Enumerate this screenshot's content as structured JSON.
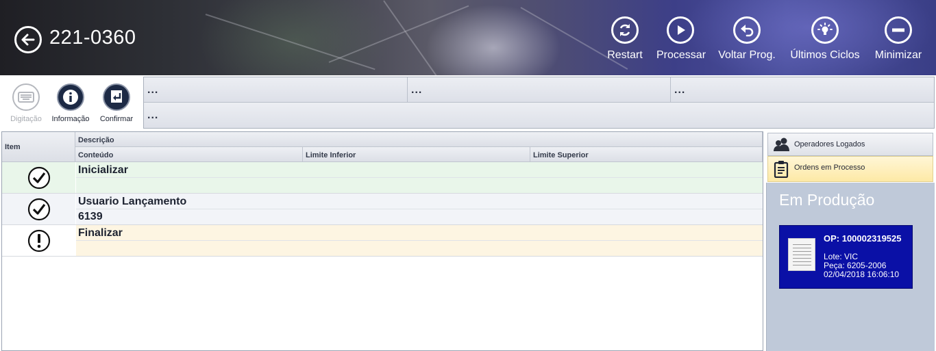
{
  "header": {
    "title": "221-0360",
    "back_icon": "arrow-left-icon",
    "actions": [
      {
        "label": "Restart",
        "icon": "restart-icon"
      },
      {
        "label": "Processar",
        "icon": "play-icon"
      },
      {
        "label": "Voltar Prog.",
        "icon": "undo-icon"
      },
      {
        "label": "Últimos Ciclos",
        "icon": "lightbulb-icon"
      },
      {
        "label": "Minimizar",
        "icon": "minus-icon"
      }
    ]
  },
  "toolbar": {
    "buttons": [
      {
        "label": "Digitação",
        "icon": "keyboard-icon",
        "enabled": false
      },
      {
        "label": "Informação",
        "icon": "info-icon",
        "enabled": true
      },
      {
        "label": "Confirmar",
        "icon": "enter-icon",
        "enabled": true
      }
    ],
    "info_cells": [
      "...",
      "...",
      "...",
      "..."
    ]
  },
  "table": {
    "headers": {
      "item": "Item",
      "descricao": "Descrição",
      "conteudo": "Conteúdo",
      "limite_inferior": "Limite Inferior",
      "limite_superior": "Limite Superior"
    },
    "rows": [
      {
        "descricao": "Inicializar",
        "conteudo": "",
        "status": "done",
        "icon": "check-circle-icon",
        "bg": "#e9f6ea"
      },
      {
        "descricao": "Usuario Lançamento",
        "conteudo": "6139",
        "status": "done",
        "icon": "check-circle-icon",
        "bg": "#f2f4f8"
      },
      {
        "descricao": "Finalizar",
        "conteudo": "",
        "status": "pending",
        "icon": "exclamation-circle-icon",
        "bg": "#fdf5e2"
      }
    ]
  },
  "side": {
    "tabs": [
      {
        "label": "Operadores Logados",
        "icon": "users-icon"
      },
      {
        "label": "Ordens em Processo",
        "icon": "clipboard-icon"
      }
    ],
    "heading": "Em Produção",
    "card": {
      "op": "OP: 100002319525",
      "lote": "Lote: VIC",
      "peca": "Peça: 6205-2006",
      "data": "02/04/2018 16:06:10",
      "icon": "document-icon"
    }
  },
  "colors": {
    "card_blue": "#0a10a6",
    "panel_bg": "#bfc9d9",
    "active_tab": "#fde9a6",
    "row_done": "#e9f6ea",
    "row_pending": "#fdf5e2"
  }
}
